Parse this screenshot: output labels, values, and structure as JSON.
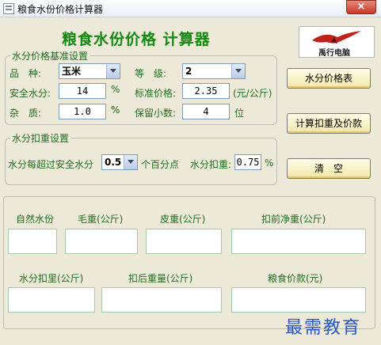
{
  "window": {
    "title": "粮食水份价格计算器",
    "close_glyph": "×"
  },
  "header": {
    "app_title": "粮食水份价格 计算器",
    "logo_text": "禹行电脑"
  },
  "price_settings": {
    "legend": "水分价格基准设置",
    "variety_label": "品　种:",
    "variety_value": "玉米",
    "grade_label": "等　级:",
    "grade_value": "2",
    "safe_moisture_label": "安全水分:",
    "safe_moisture_value": "14",
    "safe_moisture_unit": "%",
    "standard_price_label": "标准价格:",
    "standard_price_value": "2.35",
    "standard_price_unit": "(元/公斤)",
    "impurity_label": "杂　质:",
    "impurity_value": "1.0",
    "impurity_unit": "%",
    "decimals_label": "保留小数:",
    "decimals_value": "4",
    "decimals_unit": "位"
  },
  "deduction_settings": {
    "legend": "水分扣重设置",
    "over_label": "水分每超过安全水分",
    "over_value": "0.5",
    "over_unit": "个百分点",
    "deduct_label": "水分扣重:",
    "deduct_value": "0.75",
    "deduct_unit": "%"
  },
  "buttons": {
    "moisture_price_table": "水分价格表",
    "calculate": "计算扣重及价款",
    "clear": "清　空"
  },
  "results": {
    "natural_moisture_label": "自然水份",
    "gross_weight_label": "毛重(公斤)",
    "tare_weight_label": "皮重(公斤)",
    "net_before_label": "扣前净重(公斤)",
    "moisture_deduct_label": "水分扣里(公斤)",
    "after_deduct_label": "扣后重量(公斤)",
    "grain_price_label": "粮食价款(元)",
    "natural_moisture_value": "",
    "gross_weight_value": "",
    "tare_weight_value": "",
    "net_before_value": "",
    "moisture_deduct_value": "",
    "after_deduct_value": "",
    "grain_price_value": ""
  },
  "watermark": "最需教育"
}
